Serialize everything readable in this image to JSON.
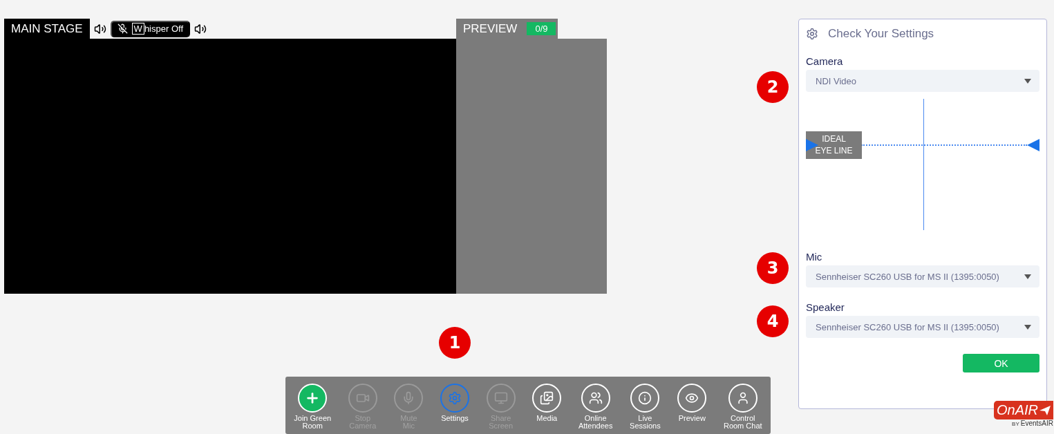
{
  "stage": {
    "title": "MAIN STAGE",
    "whisper": {
      "key": "W",
      "label": "hisper Off"
    }
  },
  "preview": {
    "title": "PREVIEW",
    "count": "0/9"
  },
  "toolbar": [
    {
      "kind": "add",
      "lines": [
        "Join Green",
        "Room"
      ],
      "disabled": false,
      "selected": false
    },
    {
      "kind": "camera",
      "lines": [
        "Stop",
        "Camera"
      ],
      "disabled": true,
      "selected": false
    },
    {
      "kind": "mic",
      "lines": [
        "Mute",
        "Mic"
      ],
      "disabled": true,
      "selected": false
    },
    {
      "kind": "settings",
      "lines": [
        "Settings"
      ],
      "disabled": false,
      "selected": true
    },
    {
      "kind": "screen",
      "lines": [
        "Share",
        "Screen"
      ],
      "disabled": true,
      "selected": false
    },
    {
      "kind": "media",
      "lines": [
        "Media"
      ],
      "disabled": false,
      "selected": false
    },
    {
      "kind": "attendees",
      "lines": [
        "Online",
        "Attendees"
      ],
      "disabled": false,
      "selected": false
    },
    {
      "kind": "info",
      "lines": [
        "Live",
        "Sessions"
      ],
      "disabled": false,
      "selected": false
    },
    {
      "kind": "eye",
      "lines": [
        "Preview"
      ],
      "disabled": false,
      "selected": false
    },
    {
      "kind": "user",
      "lines": [
        "Control",
        "Room Chat"
      ],
      "disabled": false,
      "selected": false
    }
  ],
  "settings": {
    "title": "Check Your Settings",
    "fields": [
      {
        "kind": "select",
        "label": "Camera",
        "value": "NDI Video"
      },
      {
        "kind": "camera_preview",
        "eye_line": [
          "IDEAL",
          "EYE LINE"
        ]
      },
      {
        "kind": "select",
        "label": "Mic",
        "value": "Sennheiser SC260 USB for MS II (1395:0050)"
      },
      {
        "kind": "select",
        "label": "Speaker",
        "value": "Sennheiser SC260 USB for MS II (1395:0050)"
      }
    ],
    "ok": "OK"
  },
  "markers": [
    "1",
    "2",
    "3",
    "4"
  ],
  "logo": {
    "name": "OnAIR",
    "by": "BY",
    "brand": "EventsAIR"
  }
}
